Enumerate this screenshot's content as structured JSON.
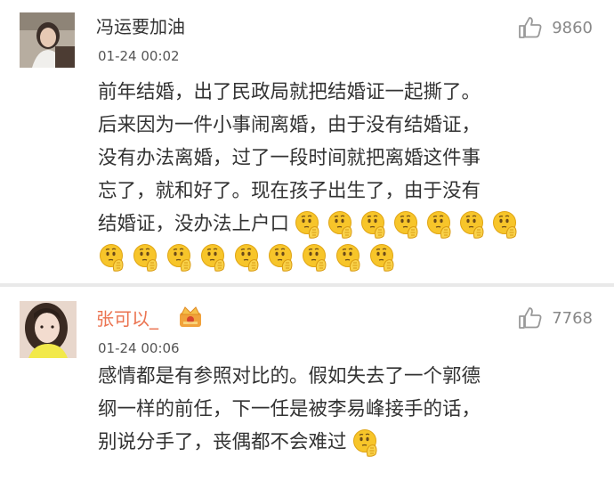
{
  "comments": [
    {
      "username": "冯运要加油",
      "time": "01-24 00:02",
      "likes": "9860",
      "lines": [
        "前年结婚，出了民政局就把结婚证一起撕了。",
        "后来因为一件小事闹离婚，由于没有结婚证，",
        "没有办法离婚，过了一段时间就把离婚这件事",
        "忘了，就和好了。现在孩子出生了，由于没有",
        "结婚证，没办法上户口"
      ],
      "emoji_inline_count": 7,
      "emoji_row_count": 9
    },
    {
      "username": "张可以_",
      "time": "01-24 00:06",
      "likes": "7768",
      "lines": [
        "感情都是有参照对比的。假如失去了一个郭德",
        "纲一样的前任，下一任是被李易峰接手的话，",
        "别说分手了，丧偶都不会难过"
      ],
      "emoji_inline_count": 1
    }
  ],
  "icons": {
    "like": "thumbs-up-icon",
    "emoji": "thinking-face-emoji-icon",
    "badge": "crown-vip-badge-icon"
  },
  "colors": {
    "username_highlight": "#eb7350",
    "like_gray": "#999999",
    "emoji_yellow": "#f7c52a"
  }
}
